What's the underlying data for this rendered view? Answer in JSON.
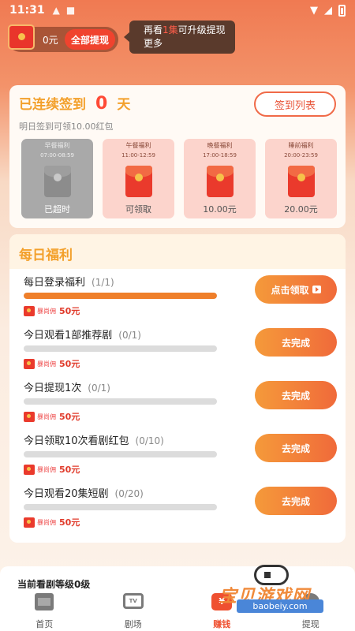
{
  "status": {
    "time": "11:31"
  },
  "wallet": {
    "amount": "0元",
    "withdraw_label": "全部提现"
  },
  "tip": {
    "text_pre": "再看",
    "highlight": "1集",
    "text_post": "可升级提现更多"
  },
  "signin": {
    "title": "已连续签到",
    "days": "0",
    "unit": "天",
    "subtitle": "明日签到可领10.00红包",
    "list_button": "签到列表",
    "slots": [
      {
        "name": "早餐福利",
        "time": "07:00-08:59",
        "label": "已超时",
        "state": "expired"
      },
      {
        "name": "午餐福利",
        "time": "11:00-12:59",
        "label": "可领取",
        "state": "available"
      },
      {
        "name": "晚餐福利",
        "time": "17:00-18:59",
        "label": "10.00元",
        "state": "upcoming"
      },
      {
        "name": "睡前福利",
        "time": "20:00-23:59",
        "label": "20.00元",
        "state": "upcoming"
      }
    ]
  },
  "daily": {
    "title": "每日福利",
    "reward_tag": "暴尚佣",
    "tasks": [
      {
        "title": "每日登录福利",
        "count": "(1/1)",
        "progress": 1.0,
        "reward": "50元",
        "button": "点击领取"
      },
      {
        "title": "今日观看1部推荐剧",
        "count": "(0/1)",
        "progress": 0.0,
        "reward": "50元",
        "button": "去完成"
      },
      {
        "title": "今日提现1次",
        "count": "(0/1)",
        "progress": 0.0,
        "reward": "50元",
        "button": "去完成"
      },
      {
        "title": "今日领取10次看剧红包",
        "count": "(0/10)",
        "progress": 0.0,
        "reward": "50元",
        "button": "去完成"
      },
      {
        "title": "今日观看20集短剧",
        "count": "(0/20)",
        "progress": 0.0,
        "reward": "50元",
        "button": "去完成"
      }
    ]
  },
  "level": {
    "text": "当前看剧等级0级"
  },
  "tabs": [
    {
      "label": "首页",
      "icon": "film-icon"
    },
    {
      "label": "剧场",
      "icon": "tv-icon"
    },
    {
      "label": "赚钱",
      "icon": "money-icon",
      "active": true
    },
    {
      "label": "提现",
      "icon": "person-icon"
    }
  ],
  "watermark": {
    "text": "宝贝游戏网",
    "url": "baobeiy.com"
  },
  "colors": {
    "accent": "#ef5030",
    "title_gold": "#f3a02b",
    "button_start": "#f59a3a",
    "button_end": "#f06a3a"
  }
}
